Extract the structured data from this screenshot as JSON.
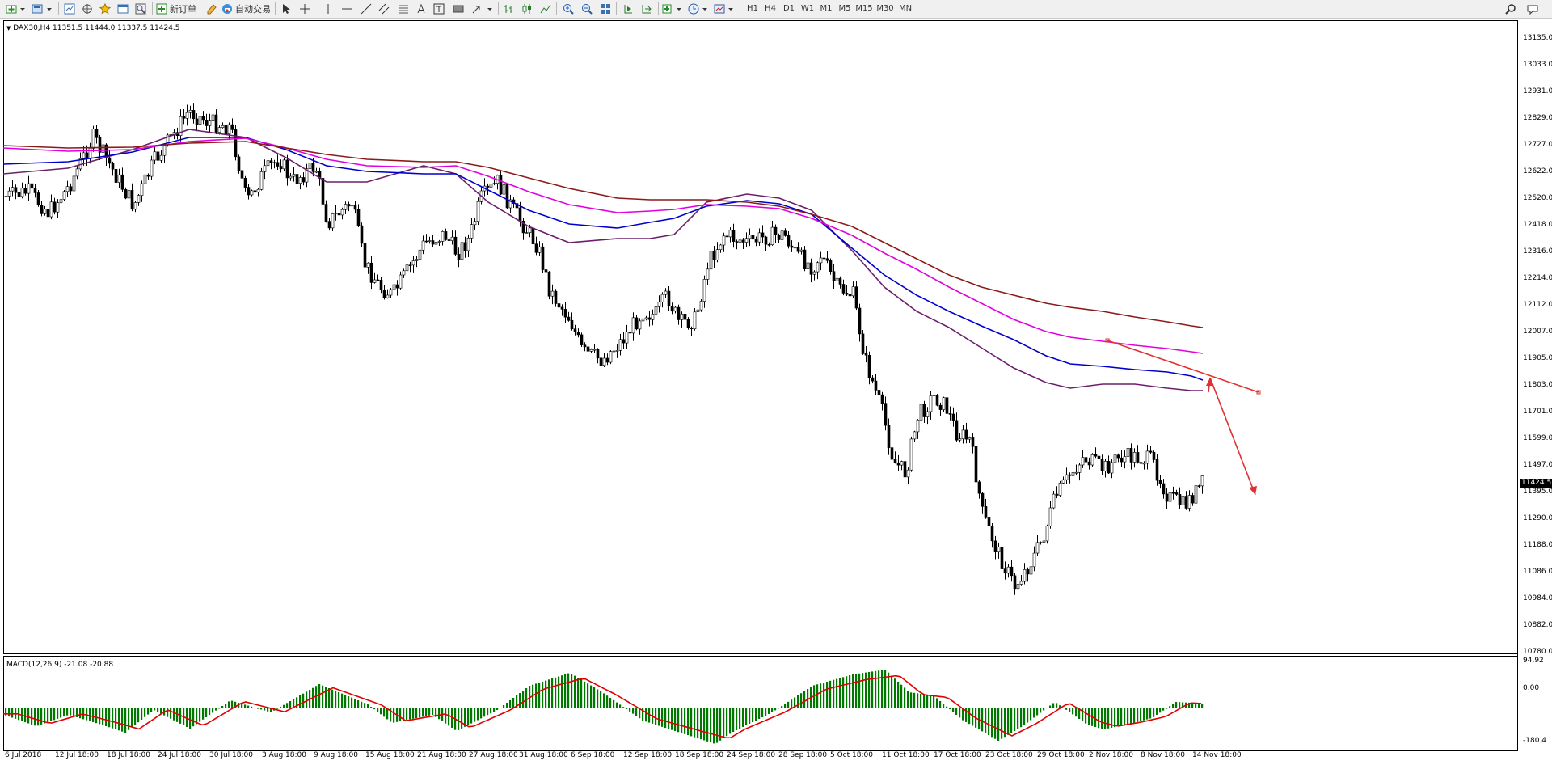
{
  "toolbar": {
    "new_order_label": "新订单",
    "auto_trading_label": "自动交易",
    "timeframes": [
      "H1",
      "H4",
      "D1",
      "W1",
      "M1",
      "M5",
      "M15",
      "M30",
      "MN"
    ]
  },
  "chart": {
    "symbol_line": "DAX30,H4  11351.5 11444.0 11337.5 11424.5",
    "current_price": "11424.5",
    "price_axis": [
      "13135.0",
      "13033.0",
      "12931.0",
      "12829.0",
      "12727.0",
      "12622.0",
      "12520.0",
      "12418.0",
      "12316.0",
      "12214.0",
      "12112.0",
      "12007.0",
      "11905.0",
      "11803.0",
      "11701.0",
      "11599.0",
      "11497.0",
      "11395.0",
      "11290.0",
      "11188.0",
      "11086.0",
      "10984.0",
      "10882.0",
      "10780.0"
    ],
    "time_axis": [
      "6 Jul 2018",
      "12 Jul 18:00",
      "18 Jul 18:00",
      "24 Jul 18:00",
      "30 Jul 18:00",
      "3 Aug 18:00",
      "9 Aug 18:00",
      "15 Aug 18:00",
      "21 Aug 18:00",
      "27 Aug 18:00",
      "31 Aug 18:00",
      "6 Sep 18:00",
      "12 Sep 18:00",
      "18 Sep 18:00",
      "24 Sep 18:00",
      "28 Sep 18:00",
      "5 Oct 18:00",
      "11 Oct 18:00",
      "17 Oct 18:00",
      "23 Oct 18:00",
      "29 Oct 18:00",
      "2 Nov 18:00",
      "8 Nov 18:00",
      "14 Nov 18:00"
    ],
    "ma_colors": [
      "#6b1f6b",
      "#0000cc",
      "#e000e0",
      "#8b1a1a"
    ],
    "annotation_color": "#e03030"
  },
  "macd": {
    "label": "MACD(12,26,9) -21.08 -20.88",
    "axis": [
      "94.92",
      "0.00",
      "-180.4"
    ],
    "hist_color": "#007800",
    "signal_color": "#e00000"
  }
}
